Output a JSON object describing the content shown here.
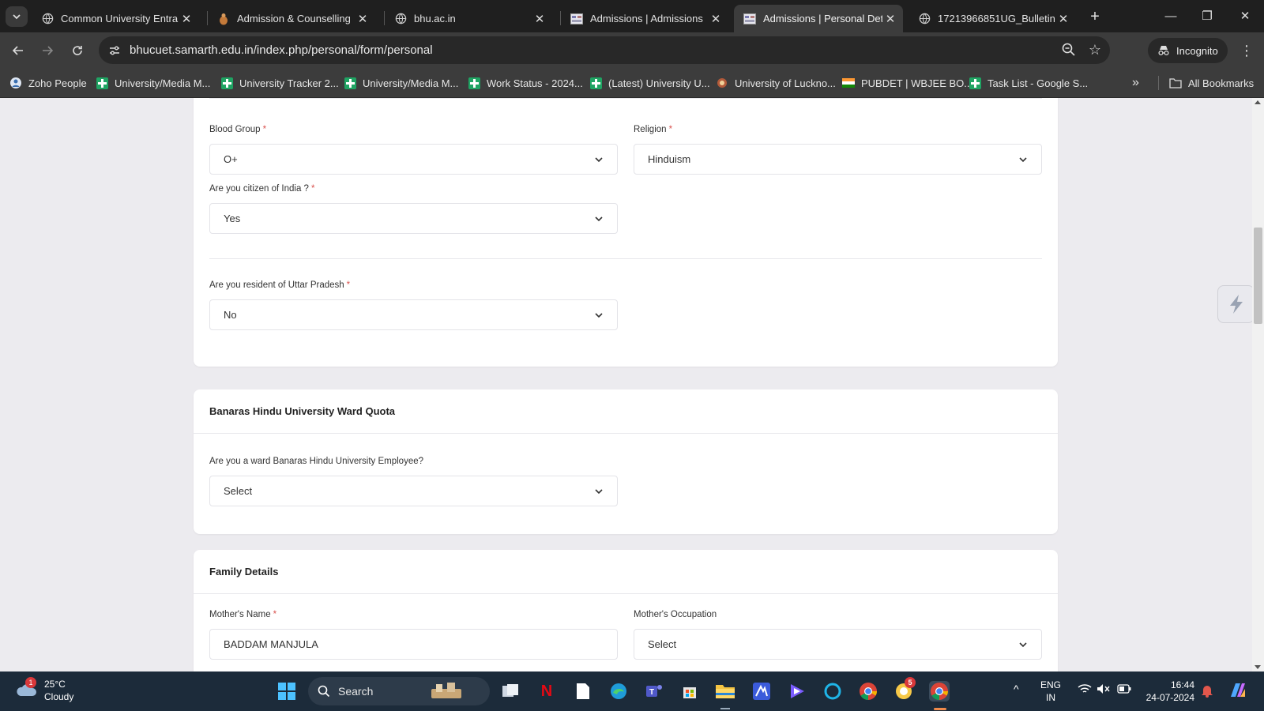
{
  "browser": {
    "tabs": [
      {
        "title": "Common University Entran",
        "icon": "globe-icon",
        "active": false
      },
      {
        "title": "Admission & Counselling",
        "icon": "university-logo-icon",
        "active": false
      },
      {
        "title": "bhu.ac.in",
        "icon": "globe-icon",
        "active": false
      },
      {
        "title": "Admissions | Admissions",
        "icon": "samarth-logo-icon",
        "active": false
      },
      {
        "title": "Admissions | Personal Det",
        "icon": "samarth-logo-icon",
        "active": true
      },
      {
        "title": "17213966851UG_Bulletin-",
        "icon": "globe-icon",
        "active": false
      }
    ],
    "new_tab_label": "+",
    "url": "bhucuet.samarth.edu.in/index.php/personal/form/personal",
    "incognito_label": "Incognito",
    "bookmarks": [
      {
        "label": "Zoho People",
        "icon": "zoho-icon"
      },
      {
        "label": "University/Media M...",
        "icon": "sheets-icon"
      },
      {
        "label": "University Tracker 2...",
        "icon": "sheets-icon"
      },
      {
        "label": "University/Media M...",
        "icon": "sheets-icon"
      },
      {
        "label": "Work Status - 2024...",
        "icon": "sheets-icon"
      },
      {
        "label": "(Latest) University U...",
        "icon": "sheets-icon"
      },
      {
        "label": "University of Luckno...",
        "icon": "university-logo-icon"
      },
      {
        "label": "PUBDET | WBJEE BO...",
        "icon": "india-flag-icon"
      },
      {
        "label": "Task List - Google S...",
        "icon": "sheets-icon"
      }
    ],
    "bookmarks_overflow": "»",
    "all_bookmarks_label": "All Bookmarks"
  },
  "form": {
    "blood_group": {
      "label": "Blood Group",
      "value": "O+"
    },
    "religion": {
      "label": "Religion",
      "value": "Hinduism"
    },
    "citizen": {
      "label": "Are you citizen of India ?",
      "value": "Yes"
    },
    "resident_up": {
      "label": "Are you resident of Uttar Pradesh",
      "value": "No"
    },
    "ward_section": {
      "title": "Banaras Hindu University Ward Quota",
      "question": "Are you a ward Banaras Hindu University Employee?",
      "value": "Select"
    },
    "family_section": {
      "title": "Family Details",
      "mother_name_label": "Mother's Name",
      "mother_name_value": "BADDAM MANJULA",
      "mother_occupation_label": "Mother's Occupation",
      "mother_occupation_value": "Select"
    },
    "required_mark": "*"
  },
  "taskbar": {
    "weather_temp": "25°C",
    "weather_desc": "Cloudy",
    "weather_badge": "1",
    "search_label": "Search",
    "lang_top": "ENG",
    "lang_bottom": "IN",
    "time": "16:44",
    "date": "24-07-2024",
    "chat_badge": "5"
  },
  "colors": {
    "accent_required": "#d9534f",
    "taskbar_bg": "#1c2b3a",
    "browser_chrome": "#3c3c3c"
  }
}
